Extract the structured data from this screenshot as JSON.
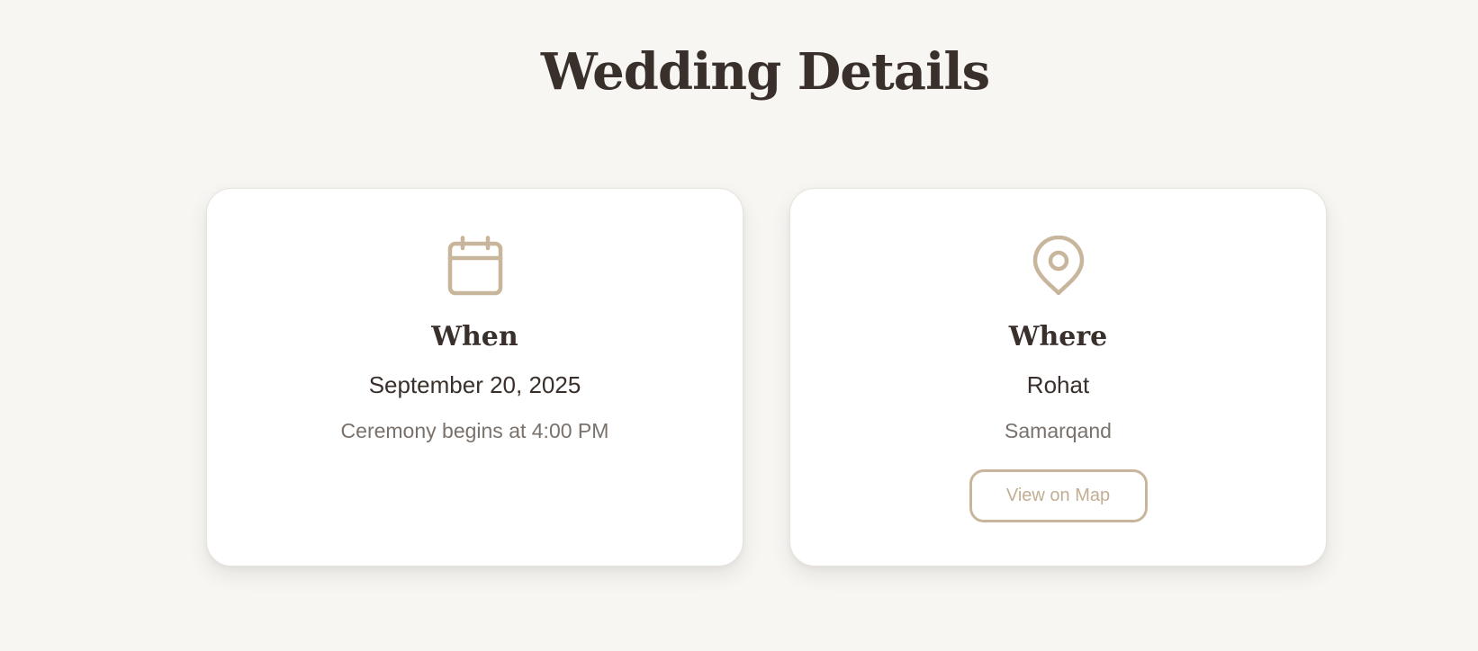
{
  "page": {
    "title": "Wedding Details"
  },
  "colors": {
    "background": "#f7f6f3",
    "accent": "#c8b69c",
    "heading": "#3a302b",
    "muted": "#7a716b"
  },
  "when_card": {
    "icon": "calendar-icon",
    "heading": "When",
    "date": "September 20, 2025",
    "detail": "Ceremony begins at 4:00 PM"
  },
  "where_card": {
    "icon": "map-pin-icon",
    "heading": "Where",
    "venue": "Rohat",
    "city": "Samarqand",
    "map_button_label": "View on Map"
  }
}
